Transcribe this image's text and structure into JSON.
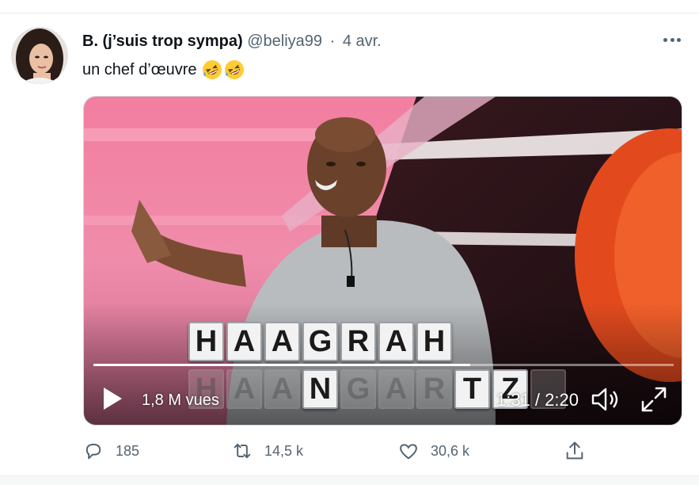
{
  "tweet": {
    "author_name": "B. (j’suis trop sympa)",
    "handle": "@beliya99",
    "separator": "·",
    "date": "4 avr.",
    "text": "un chef d’œuvre",
    "emojis": [
      "rolling-on-floor-laughing",
      "rolling-on-floor-laughing"
    ]
  },
  "video": {
    "tiles_top": [
      "H",
      "A",
      "A",
      "G",
      "R",
      "A",
      "H"
    ],
    "tiles_bottom": [
      "H",
      "A",
      "A",
      "N",
      "G",
      "A",
      "R",
      "T",
      "Z",
      "H"
    ],
    "views": "1,8 M vues",
    "time": "1:31 / 2:20",
    "progress": 0.65
  },
  "actions": {
    "reply_count": "185",
    "retweet_count": "14,5 k",
    "like_count": "30,6 k"
  },
  "colors": {
    "text_primary": "#0f1419",
    "text_secondary": "#536471",
    "border": "#e6ecf0"
  },
  "icons": {
    "more": "more-dots-icon",
    "play": "play-icon",
    "volume": "volume-icon",
    "fullscreen": "fullscreen-icon",
    "reply": "reply-icon",
    "retweet": "retweet-icon",
    "like": "like-icon",
    "share": "share-icon"
  }
}
